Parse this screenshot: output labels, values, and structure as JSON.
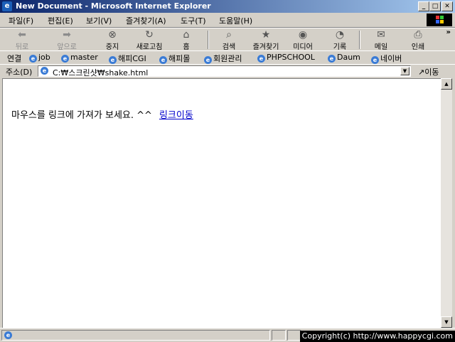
{
  "window": {
    "title": "New Document - Microsoft Internet Explorer"
  },
  "menu": [
    "파일(F)",
    "편집(E)",
    "보기(V)",
    "즐겨찾기(A)",
    "도구(T)",
    "도움말(H)"
  ],
  "toolbar": {
    "back": "뒤로",
    "forward": "앞으로",
    "stop": "중지",
    "refresh": "새로고침",
    "home": "홈",
    "search": "검색",
    "favorites": "즐겨찾기",
    "media": "미디어",
    "history": "기록",
    "mail": "메일",
    "print": "인쇄"
  },
  "links": {
    "label": "연결",
    "items": [
      "job",
      "master",
      "해피CGI",
      "해피몰",
      "회원관리",
      "PHPSCHOOL",
      "Daum",
      "네이버"
    ]
  },
  "address": {
    "label": "주소(D)",
    "value": "C:₩스크린샷₩shake.html",
    "go": "이동"
  },
  "page": {
    "message": "마우스를 링크에 가져가 보세요. ^^",
    "link": "링크이동"
  },
  "status": {
    "copyright": "Copyright(c) http://www.happycgi.com"
  }
}
